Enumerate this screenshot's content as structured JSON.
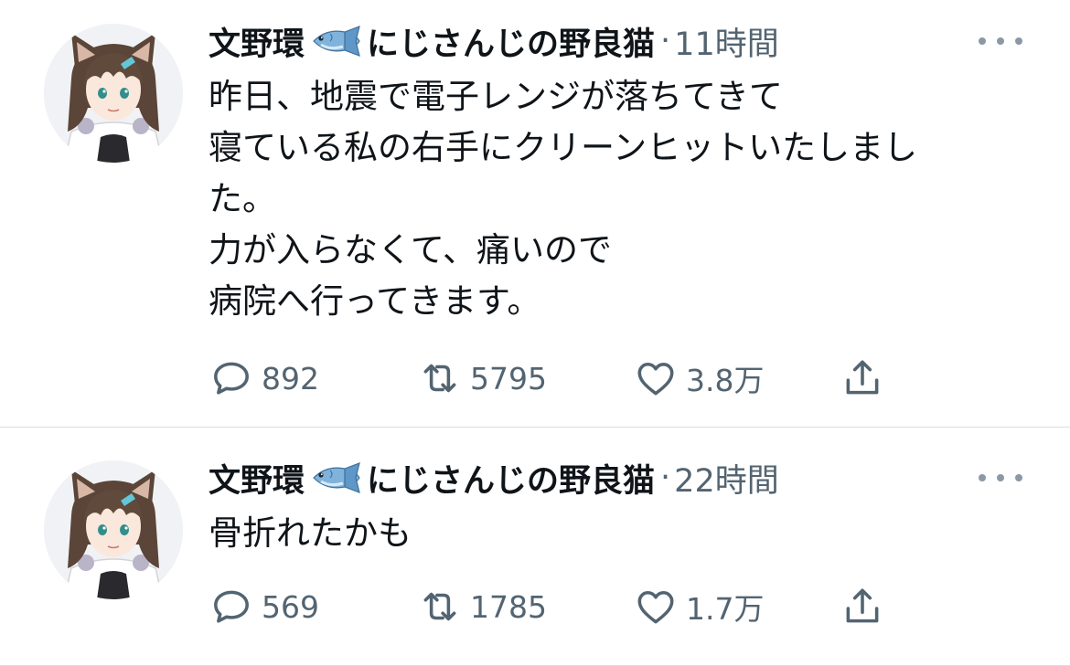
{
  "colors": {
    "text_primary": "#0f1419",
    "text_secondary": "#536471",
    "divider": "#d9dde1",
    "fish_body": "#7fb3dc"
  },
  "tweets": [
    {
      "author": {
        "name_prefix": "文野環",
        "emoji": "fish-emoji",
        "name_suffix": "にじさんじの野良猫"
      },
      "separator": "·",
      "time": "11時間",
      "lines": [
        "昨日、地震で電子レンジが落ちてきて",
        "寝ている私の右手にクリーンヒットいたしまし",
        "た。",
        "力が入らなくて、痛いので",
        "病院へ行ってきます。"
      ],
      "stats": {
        "replies": "892",
        "retweets": "5795",
        "likes": "3.8万"
      }
    },
    {
      "author": {
        "name_prefix": "文野環",
        "emoji": "fish-emoji",
        "name_suffix": "にじさんじの野良猫"
      },
      "separator": "·",
      "time": "22時間",
      "lines": [
        "骨折れたかも"
      ],
      "stats": {
        "replies": "569",
        "retweets": "1785",
        "likes": "1.7万"
      }
    }
  ],
  "icons": {
    "reply": "reply-icon",
    "retweet": "retweet-icon",
    "like": "heart-icon",
    "share": "share-icon",
    "more": "more-icon"
  }
}
